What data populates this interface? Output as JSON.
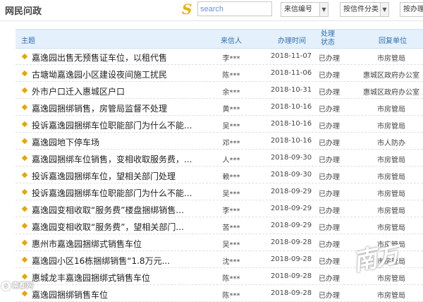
{
  "header": {
    "site_title": "网民问政",
    "logo_glyph": "S",
    "search_placeholder": "search",
    "selects": [
      {
        "label": "来信编号"
      },
      {
        "label": "按信件分类"
      },
      {
        "label": "按办理"
      }
    ]
  },
  "table": {
    "columns": {
      "subject": "主题",
      "sender": "来信人",
      "time": "办理时间",
      "status": "处理状态",
      "unit": "回复单位"
    },
    "rows": [
      {
        "subject": "嘉逸园出售无预售证车位，以租代售",
        "sender": "李***",
        "time": "2018-11-07",
        "status": "已办理",
        "unit": "市房管局"
      },
      {
        "subject": "古塘坳嘉逸园小区建设夜间施工扰民",
        "sender": "陈***",
        "time": "2018-11-06",
        "status": "已办理",
        "unit": "惠城区政府办公室"
      },
      {
        "subject": "外市户口迁入惠城区户口",
        "sender": "余***",
        "time": "2018-10-31",
        "status": "已办理",
        "unit": "惠城区政府办公室"
      },
      {
        "subject": "嘉逸园捆绑销售，房管局监督不处理",
        "sender": "黄***",
        "time": "2018-10-16",
        "status": "已办理",
        "unit": "市房管局"
      },
      {
        "subject": "投诉嘉逸园捆绑车位职能部门为什么不能...",
        "sender": "吴***",
        "time": "2018-10-16",
        "status": "已办理",
        "unit": "市房管局"
      },
      {
        "subject": "嘉逸园地下停车场",
        "sender": "邓***",
        "time": "2018-10-16",
        "status": "已办理",
        "unit": "市人防办"
      },
      {
        "subject": "嘉逸园捆绑车位销售，变相收取服务费，...",
        "sender": "人***",
        "time": "2018-09-30",
        "status": "已办理",
        "unit": "市房管局"
      },
      {
        "subject": "投诉嘉逸园捆绑车位，望相关部门处理",
        "sender": "赖***",
        "time": "2018-09-30",
        "status": "已办理",
        "unit": "市房管局"
      },
      {
        "subject": "投诉嘉逸园捆绑车位职能部门为什么不能...",
        "sender": "吴***",
        "time": "2018-09-29",
        "status": "已办理",
        "unit": "市房管局"
      },
      {
        "subject": "嘉逸园变相收取“服务费”楼盘捆绑销售...",
        "sender": "李***",
        "time": "2018-09-29",
        "status": "已办理",
        "unit": "市房管局"
      },
      {
        "subject": "嘉逸园变相收取“服务费”，望相关部门...",
        "sender": "苦***",
        "time": "2018-09-29",
        "status": "已办理",
        "unit": "市房管局"
      },
      {
        "subject": "惠州市嘉逸园捆绑式销售车位",
        "sender": "吴***",
        "time": "2018-09-28",
        "status": "已办理",
        "unit": "市房管局"
      },
      {
        "subject": "嘉逸园小区16栋捆绑销售“1.8万元...",
        "sender": "沈***",
        "time": "2018-09-28",
        "status": "已办理",
        "unit": "市房管局"
      },
      {
        "subject": "惠城龙丰嘉逸园捆绑式销售车位",
        "sender": "陈***",
        "time": "2018-09-28",
        "status": "已办理",
        "unit": "市房管局"
      },
      {
        "subject": "嘉逸园捆绑销售车位",
        "sender": "陈***",
        "time": "2018-09-28",
        "status": "已办理",
        "unit": "市房管局"
      }
    ]
  },
  "watermark": {
    "left_text": "南都网",
    "right_text": "南方"
  },
  "colors": {
    "bullet": "#e6a700",
    "header_bg": "#e4f0fb",
    "header_text": "#2f6fb0"
  }
}
